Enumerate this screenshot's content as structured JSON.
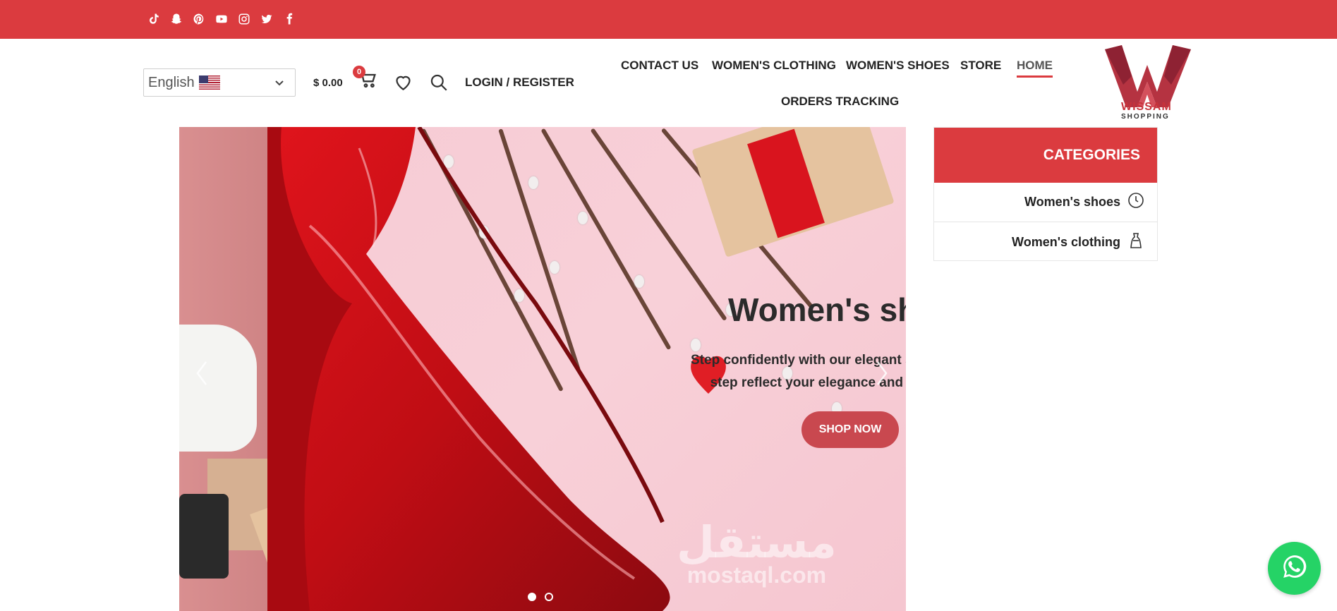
{
  "topbar": {
    "color": "#db3b3f",
    "social_icons": [
      "tiktok-icon",
      "snapchat-icon",
      "pinterest-icon",
      "youtube-icon",
      "instagram-icon",
      "twitter-icon",
      "facebook-icon"
    ]
  },
  "header": {
    "language": {
      "selected": "English",
      "flag": "us-flag-icon"
    },
    "cart": {
      "total": "$ 0.00",
      "count": "0"
    },
    "login_label": "LOGIN / REGISTER",
    "nav": {
      "contact": "CONTACT US",
      "womens_clothing": "WOMEN'S CLOTHING",
      "womens_shoes": "WOMEN'S SHOES",
      "store": "STORE",
      "home": "HOME",
      "orders_tracking": "ORDERS TRACKING"
    },
    "logo": {
      "line1": "WISSAM",
      "line2": "SHOPPING"
    }
  },
  "hero": {
    "title": "Women's shoes",
    "subtitle_line1": "Step confidently with our elegant shoes - let every",
    "subtitle_line2": "step reflect your elegance and distinction",
    "button": "SHOP NOW",
    "slides_count": 2,
    "active_slide": 1,
    "watermark_ar": "مستقل",
    "watermark_lat": "mostaql.com"
  },
  "categories": {
    "title": "CATEGORIES",
    "items": [
      {
        "label": "Women's shoes",
        "icon": "clock-icon"
      },
      {
        "label": "Women's clothing",
        "icon": "dress-icon"
      }
    ]
  },
  "floating": {
    "whatsapp_icon": "whatsapp-icon"
  }
}
